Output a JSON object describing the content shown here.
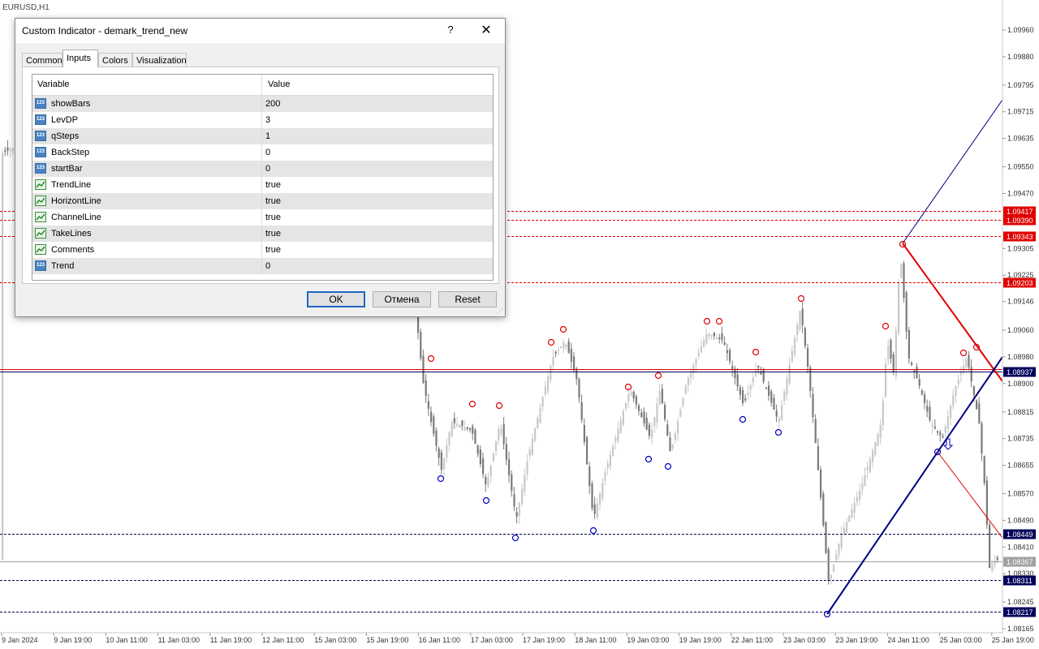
{
  "chart": {
    "symbol": "EURUSD,H1",
    "price_ticks": [
      "1.09960",
      "1.09880",
      "1.09795",
      "1.09715",
      "1.09635",
      "1.09550",
      "1.09470",
      "1.09390",
      "1.09305",
      "1.09225",
      "1.09146",
      "1.09060",
      "1.08980",
      "1.08900",
      "1.08815",
      "1.08735",
      "1.08655",
      "1.08570",
      "1.08490",
      "1.08410",
      "1.08330",
      "1.08245",
      "1.08165"
    ],
    "time_ticks": [
      "9 Jan 2024",
      "9 Jan 19:00",
      "10 Jan 11:00",
      "11 Jan 03:00",
      "11 Jan 19:00",
      "12 Jan 11:00",
      "15 Jan 03:00",
      "15 Jan 19:00",
      "16 Jan 11:00",
      "17 Jan 03:00",
      "17 Jan 19:00",
      "18 Jan 11:00",
      "19 Jan 03:00",
      "19 Jan 19:00",
      "22 Jan 11:00",
      "23 Jan 03:00",
      "23 Jan 19:00",
      "24 Jan 11:00",
      "25 Jan 03:00",
      "25 Jan 19:00"
    ],
    "levels": [
      {
        "price": "1.09417",
        "color": "#e00000",
        "style": "dashed"
      },
      {
        "price": "1.09390",
        "color": "#e00000",
        "style": "dashed"
      },
      {
        "price": "1.09343",
        "color": "#e00000",
        "style": "dashed"
      },
      {
        "price": "1.09203",
        "color": "#e00000",
        "style": "dashed"
      },
      {
        "price": "1.08937",
        "color": "#00005a",
        "style": "solid"
      },
      {
        "price": "1.08449",
        "color": "#00005a",
        "style": "dashed"
      },
      {
        "price": "1.08367",
        "color": "#a0a0a0",
        "style": "solid"
      },
      {
        "price": "1.08311",
        "color": "#00005a",
        "style": "dashed"
      },
      {
        "price": "1.08217",
        "color": "#00005a",
        "style": "dashed"
      }
    ],
    "colors": {
      "up": "#c8c8c8",
      "down": "#7a7a7a",
      "resistance": "#e00000",
      "support": "#0000c0",
      "trend": "#000080"
    }
  },
  "dialog": {
    "title": "Custom Indicator - demark_trend_new",
    "help_label": "?",
    "close_label": "✕",
    "tabs": [
      "Common",
      "Inputs",
      "Colors",
      "Visualization"
    ],
    "active_tab": "Inputs",
    "columns": [
      "Variable",
      "Value"
    ],
    "params": [
      {
        "name": "showBars",
        "value": "200",
        "type": "int"
      },
      {
        "name": "LevDP",
        "value": "3",
        "type": "int"
      },
      {
        "name": "qSteps",
        "value": "1",
        "type": "int"
      },
      {
        "name": "BackStep",
        "value": "0",
        "type": "int"
      },
      {
        "name": "startBar",
        "value": "0",
        "type": "int"
      },
      {
        "name": "TrendLine",
        "value": "true",
        "type": "bool"
      },
      {
        "name": "HorizontLine",
        "value": "true",
        "type": "bool"
      },
      {
        "name": "ChannelLine",
        "value": "true",
        "type": "bool"
      },
      {
        "name": "TakeLines",
        "value": "true",
        "type": "bool"
      },
      {
        "name": "Comments",
        "value": "true",
        "type": "bool"
      },
      {
        "name": "Trend",
        "value": "0",
        "type": "int"
      }
    ],
    "int_icon_text": "123",
    "buttons": {
      "ok": "OK",
      "cancel": "Отмена",
      "reset": "Reset"
    }
  }
}
